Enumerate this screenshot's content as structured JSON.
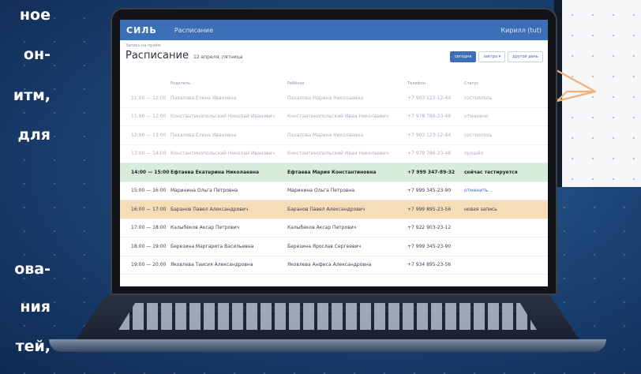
{
  "left_text": {
    "lines": [
      "ное",
      "он-",
      "итм,",
      "для",
      "ова-",
      "ния",
      "тей,"
    ]
  },
  "app": {
    "logo": "СИЛЬ",
    "nav_item": "Расписание",
    "user": "Кирилл (tut)"
  },
  "page": {
    "breadcrumb": "Запись на приём",
    "title": "Расписание",
    "date": "12 апреля, пятница",
    "filters": [
      "сегодня",
      "завтра ▾",
      "другой день"
    ]
  },
  "table": {
    "columns": [
      "",
      "Родитель",
      "Ребёнок",
      "Телефон",
      "Статус"
    ],
    "rows": [
      {
        "time": "11:00 — 12:00",
        "parent": "Пахалова Елена Ивановна",
        "child": "Пахалова Марина Николаевна",
        "phone": "+7 903 123-12-44",
        "status": "состоялось",
        "state": "past"
      },
      {
        "time": "11:00 — 12:00",
        "parent": "Константинопольский Николай Иванович",
        "child": "Константинопольский Иван Николаевич",
        "phone": "+7 978 786-23-46",
        "status": "отменено",
        "state": "past"
      },
      {
        "time": "12:00 — 13:00",
        "parent": "Пахалова Елена Ивановна",
        "child": "Пахалова Марина Николаевна",
        "phone": "+7 903 123-12-44",
        "status": "состоялось",
        "state": "past"
      },
      {
        "time": "13:00 — 14:00",
        "parent": "Константинопольский Николай Иванович",
        "child": "Константинопольский Иван Николаевич",
        "phone": "+7 978 786-23-46",
        "status": "прошёл",
        "state": "past"
      },
      {
        "time": "14:00 — 15:00",
        "parent": "Ефтаева Екатерина Николаевна",
        "child": "Ефтаева Мария Константиновна",
        "phone": "+7 999 347-89-32",
        "status": "сейчас тестируется",
        "state": "now"
      },
      {
        "time": "15:00 — 16:00",
        "parent": "Маринина Ольга Петровна",
        "child": "Маринина Ольга Петровна",
        "phone": "+7 999 345-23-90",
        "status": "отменить...",
        "state": "link"
      },
      {
        "time": "16:00 — 17:00",
        "parent": "Баранов Павел Александрович",
        "child": "Баранов Павел Александрович",
        "phone": "+7 999 895-23-56",
        "status": "новая запись",
        "state": "new"
      },
      {
        "time": "17:00 — 18:00",
        "parent": "Калыбеков Аксар Петрович",
        "child": "Калыбеков Аксар Петрович",
        "phone": "+7 922 903-23-12",
        "status": "",
        "state": "normal"
      },
      {
        "time": "18:00 — 19:00",
        "parent": "Березина Маргарита Васильевна",
        "child": "Березина Ярослав Сергеевич",
        "phone": "+7 999 345-23-90",
        "status": "",
        "state": "normal"
      },
      {
        "time": "19:00 — 20:00",
        "parent": "Яковлева Таисия Александровна",
        "child": "Яковлева Анфиса Александровна",
        "phone": "+7 934 895-23-56",
        "status": "",
        "state": "normal"
      }
    ]
  },
  "colors": {
    "accent": "#3b6fb6",
    "current_row": "#d7ecd9",
    "new_row": "#f7dcb8",
    "plane": "#f0b27a"
  },
  "icons": [
    "paper-plane-icon"
  ]
}
